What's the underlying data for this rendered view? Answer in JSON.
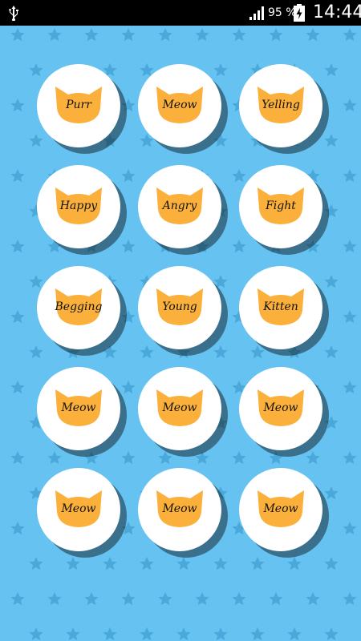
{
  "status_bar": {
    "battery_percent": "95 %",
    "time": "14:44",
    "icons": [
      "usb-icon",
      "signal-icon",
      "battery-charging-icon"
    ]
  },
  "colors": {
    "background": "#65c2f1",
    "star": "#4aa9da",
    "button": "#ffffff",
    "cat_face": "#fbb03b"
  },
  "buttons": [
    {
      "label": "Purr"
    },
    {
      "label": "Meow"
    },
    {
      "label": "Yelling"
    },
    {
      "label": "Happy"
    },
    {
      "label": "Angry"
    },
    {
      "label": "Fight"
    },
    {
      "label": "Begging"
    },
    {
      "label": "Young"
    },
    {
      "label": "Kitten"
    },
    {
      "label": "Meow"
    },
    {
      "label": "Meow"
    },
    {
      "label": "Meow"
    },
    {
      "label": "Meow"
    },
    {
      "label": "Meow"
    },
    {
      "label": "Meow"
    }
  ]
}
